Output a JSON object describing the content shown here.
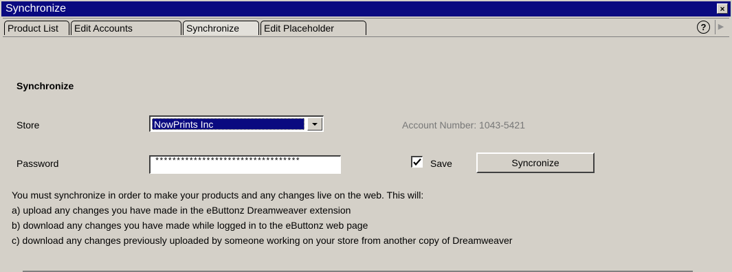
{
  "window": {
    "title": "Synchronize",
    "close_glyph": "×"
  },
  "tabs": [
    {
      "label": "Product List"
    },
    {
      "label": "Edit Accounts"
    },
    {
      "label": "Synchronize"
    },
    {
      "label": "Edit Placeholder"
    }
  ],
  "toolbar": {
    "help_glyph": "?",
    "scroll_glyph": "▶"
  },
  "form": {
    "section_title": "Synchronize",
    "store_label": "Store",
    "store_value": "NowPrints Inc",
    "account_text": "Account Number: 1043-5421",
    "password_label": "Password",
    "password_value": "**********************************",
    "save_label": "Save",
    "save_checked": true,
    "sync_button_label": "Syncronize"
  },
  "info_lines": [
    "You must synchronize in order to make your products and any changes live on the web. This will:",
    "a) upload any changes you have made in the eButtonz Dreamweaver extension",
    "b) download any changes you have made while logged in to the eButtonz web page",
    "c) download any changes previously uploaded by someone working on your store from another copy of Dreamweaver"
  ]
}
